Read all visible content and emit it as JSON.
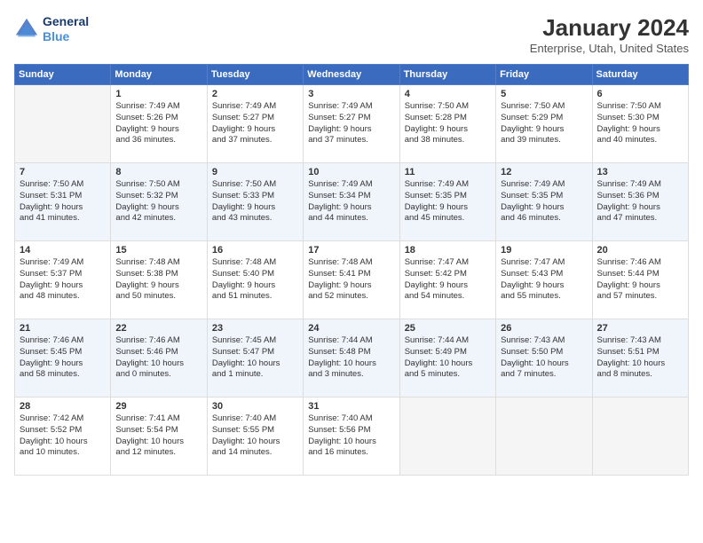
{
  "header": {
    "logo_line1": "General",
    "logo_line2": "Blue",
    "title": "January 2024",
    "subtitle": "Enterprise, Utah, United States"
  },
  "weekdays": [
    "Sunday",
    "Monday",
    "Tuesday",
    "Wednesday",
    "Thursday",
    "Friday",
    "Saturday"
  ],
  "weeks": [
    [
      {
        "day": "",
        "info": ""
      },
      {
        "day": "1",
        "info": "Sunrise: 7:49 AM\nSunset: 5:26 PM\nDaylight: 9 hours\nand 36 minutes."
      },
      {
        "day": "2",
        "info": "Sunrise: 7:49 AM\nSunset: 5:27 PM\nDaylight: 9 hours\nand 37 minutes."
      },
      {
        "day": "3",
        "info": "Sunrise: 7:49 AM\nSunset: 5:27 PM\nDaylight: 9 hours\nand 37 minutes."
      },
      {
        "day": "4",
        "info": "Sunrise: 7:50 AM\nSunset: 5:28 PM\nDaylight: 9 hours\nand 38 minutes."
      },
      {
        "day": "5",
        "info": "Sunrise: 7:50 AM\nSunset: 5:29 PM\nDaylight: 9 hours\nand 39 minutes."
      },
      {
        "day": "6",
        "info": "Sunrise: 7:50 AM\nSunset: 5:30 PM\nDaylight: 9 hours\nand 40 minutes."
      }
    ],
    [
      {
        "day": "7",
        "info": "Sunrise: 7:50 AM\nSunset: 5:31 PM\nDaylight: 9 hours\nand 41 minutes."
      },
      {
        "day": "8",
        "info": "Sunrise: 7:50 AM\nSunset: 5:32 PM\nDaylight: 9 hours\nand 42 minutes."
      },
      {
        "day": "9",
        "info": "Sunrise: 7:50 AM\nSunset: 5:33 PM\nDaylight: 9 hours\nand 43 minutes."
      },
      {
        "day": "10",
        "info": "Sunrise: 7:49 AM\nSunset: 5:34 PM\nDaylight: 9 hours\nand 44 minutes."
      },
      {
        "day": "11",
        "info": "Sunrise: 7:49 AM\nSunset: 5:35 PM\nDaylight: 9 hours\nand 45 minutes."
      },
      {
        "day": "12",
        "info": "Sunrise: 7:49 AM\nSunset: 5:35 PM\nDaylight: 9 hours\nand 46 minutes."
      },
      {
        "day": "13",
        "info": "Sunrise: 7:49 AM\nSunset: 5:36 PM\nDaylight: 9 hours\nand 47 minutes."
      }
    ],
    [
      {
        "day": "14",
        "info": "Sunrise: 7:49 AM\nSunset: 5:37 PM\nDaylight: 9 hours\nand 48 minutes."
      },
      {
        "day": "15",
        "info": "Sunrise: 7:48 AM\nSunset: 5:38 PM\nDaylight: 9 hours\nand 50 minutes."
      },
      {
        "day": "16",
        "info": "Sunrise: 7:48 AM\nSunset: 5:40 PM\nDaylight: 9 hours\nand 51 minutes."
      },
      {
        "day": "17",
        "info": "Sunrise: 7:48 AM\nSunset: 5:41 PM\nDaylight: 9 hours\nand 52 minutes."
      },
      {
        "day": "18",
        "info": "Sunrise: 7:47 AM\nSunset: 5:42 PM\nDaylight: 9 hours\nand 54 minutes."
      },
      {
        "day": "19",
        "info": "Sunrise: 7:47 AM\nSunset: 5:43 PM\nDaylight: 9 hours\nand 55 minutes."
      },
      {
        "day": "20",
        "info": "Sunrise: 7:46 AM\nSunset: 5:44 PM\nDaylight: 9 hours\nand 57 minutes."
      }
    ],
    [
      {
        "day": "21",
        "info": "Sunrise: 7:46 AM\nSunset: 5:45 PM\nDaylight: 9 hours\nand 58 minutes."
      },
      {
        "day": "22",
        "info": "Sunrise: 7:46 AM\nSunset: 5:46 PM\nDaylight: 10 hours\nand 0 minutes."
      },
      {
        "day": "23",
        "info": "Sunrise: 7:45 AM\nSunset: 5:47 PM\nDaylight: 10 hours\nand 1 minute."
      },
      {
        "day": "24",
        "info": "Sunrise: 7:44 AM\nSunset: 5:48 PM\nDaylight: 10 hours\nand 3 minutes."
      },
      {
        "day": "25",
        "info": "Sunrise: 7:44 AM\nSunset: 5:49 PM\nDaylight: 10 hours\nand 5 minutes."
      },
      {
        "day": "26",
        "info": "Sunrise: 7:43 AM\nSunset: 5:50 PM\nDaylight: 10 hours\nand 7 minutes."
      },
      {
        "day": "27",
        "info": "Sunrise: 7:43 AM\nSunset: 5:51 PM\nDaylight: 10 hours\nand 8 minutes."
      }
    ],
    [
      {
        "day": "28",
        "info": "Sunrise: 7:42 AM\nSunset: 5:52 PM\nDaylight: 10 hours\nand 10 minutes."
      },
      {
        "day": "29",
        "info": "Sunrise: 7:41 AM\nSunset: 5:54 PM\nDaylight: 10 hours\nand 12 minutes."
      },
      {
        "day": "30",
        "info": "Sunrise: 7:40 AM\nSunset: 5:55 PM\nDaylight: 10 hours\nand 14 minutes."
      },
      {
        "day": "31",
        "info": "Sunrise: 7:40 AM\nSunset: 5:56 PM\nDaylight: 10 hours\nand 16 minutes."
      },
      {
        "day": "",
        "info": ""
      },
      {
        "day": "",
        "info": ""
      },
      {
        "day": "",
        "info": ""
      }
    ]
  ]
}
